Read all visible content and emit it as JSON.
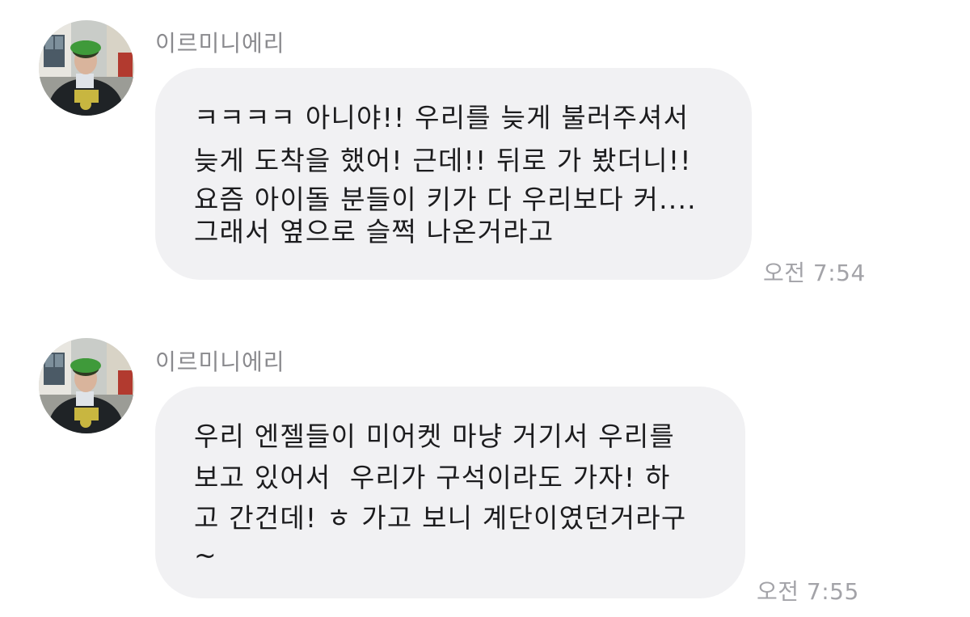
{
  "messages": [
    {
      "sender": "이르미니에리",
      "lines": [
        "ㅋㅋㅋㅋ 아니야!! 우리를 늦게 불러주셔서",
        "늦게 도착을 했어! 근데!! 뒤로 가 봤더니!!",
        "요즘 아이돌 분들이 키가 다 우리보다 커....",
        "그래서 옆으로 슬쩍 나온거라고"
      ],
      "time": "오전 7:54"
    },
    {
      "sender": "이르미니에리",
      "lines": [
        "우리 엔젤들이 미어켓 마냥 거기서 우리를",
        "보고 있어서  우리가 구석이라도 가자! 하",
        "고 간건데! ㅎ 가고 보니 계단이였던거라구",
        "~"
      ],
      "time": "오전 7:55"
    }
  ],
  "colors": {
    "bubble": "#f1f1f3",
    "text": "#1c1c1e",
    "sender": "#8a8a8e",
    "time": "#a3a3a8"
  }
}
